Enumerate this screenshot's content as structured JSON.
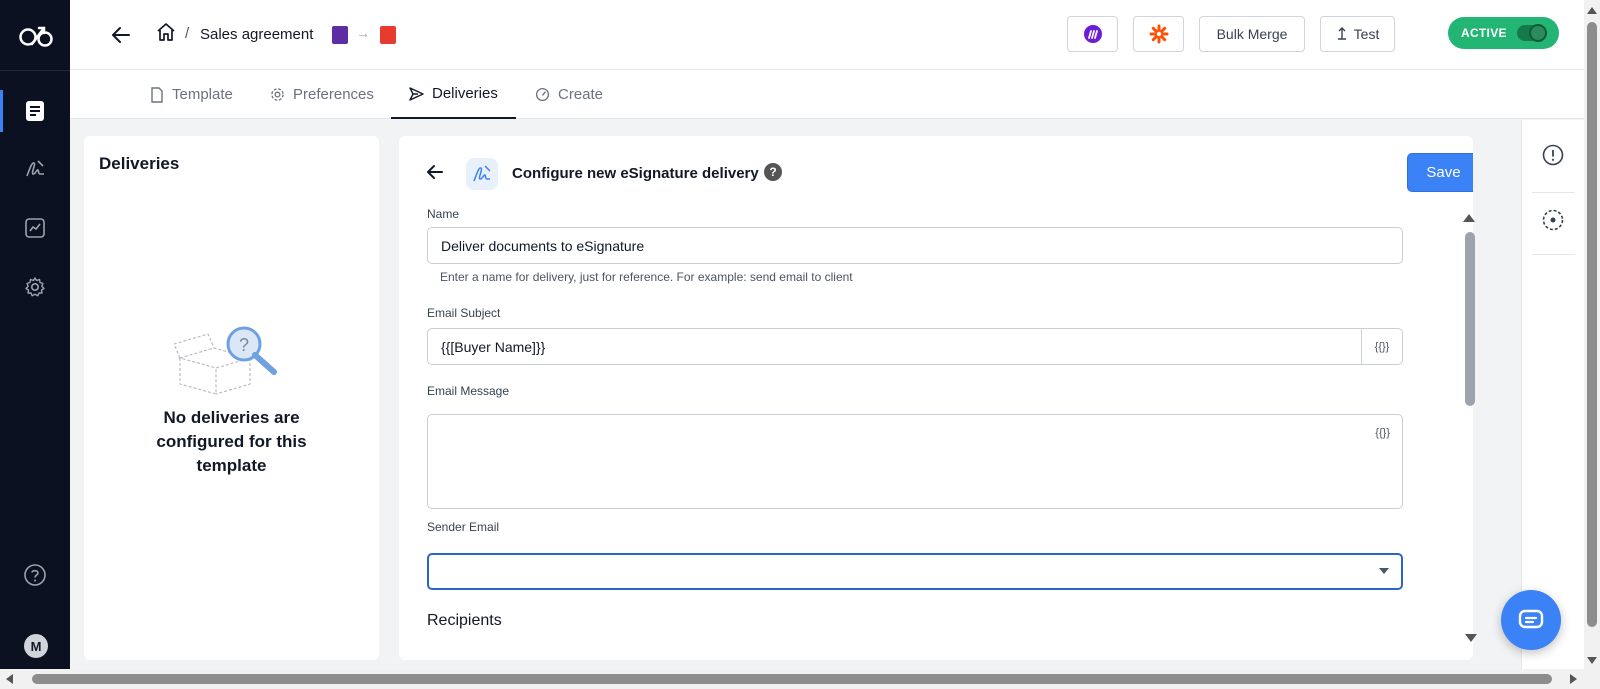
{
  "header": {
    "breadcrumb_separator": "/",
    "document_title": "Sales agreement",
    "format_arrow": "→",
    "bulk_merge_label": "Bulk Merge",
    "test_label": "Test",
    "status_label": "ACTIVE",
    "status_color": "#22b573"
  },
  "tabs": [
    {
      "label": "Template",
      "icon": "file-icon"
    },
    {
      "label": "Preferences",
      "icon": "gear-icon"
    },
    {
      "label": "Deliveries",
      "icon": "send-icon",
      "active": true
    },
    {
      "label": "Create",
      "icon": "gauge-icon"
    }
  ],
  "left_nav": {
    "items": [
      "documents-icon",
      "signature-icon",
      "chart-icon",
      "settings-icon"
    ],
    "help_icon": "help-icon",
    "avatar_initial": "M"
  },
  "deliveries_panel": {
    "title": "Deliveries",
    "empty_message": "No deliveries are configured for this template"
  },
  "form": {
    "title": "Configure new eSignature delivery",
    "help": "?",
    "save_label": "Save",
    "name_label": "Name",
    "name_value": "Deliver documents to eSignature",
    "name_hint": "Enter a name for delivery, just for reference. For example: send email to client",
    "subject_label": "Email Subject",
    "subject_value": "{{[Buyer Name]}}",
    "token_button": "{{}}",
    "message_label": "Email Message",
    "message_value": "",
    "sender_label": "Sender Email",
    "sender_value": "",
    "recipients_title": "Recipients"
  },
  "colors": {
    "accent": "#3b82f6",
    "nav_bg": "#0b1120"
  }
}
